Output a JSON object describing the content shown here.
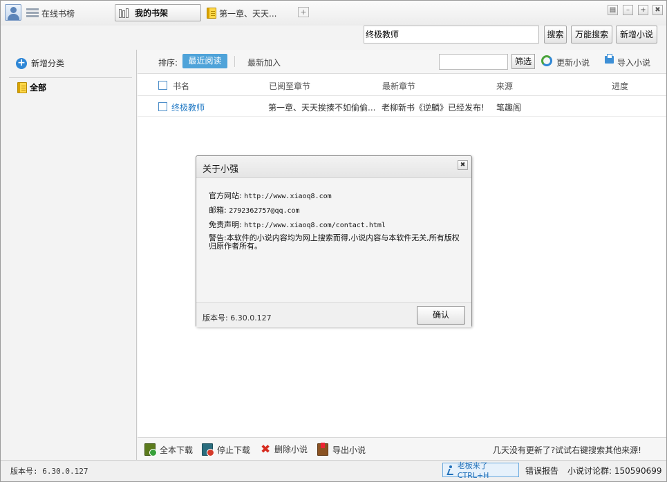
{
  "tabs": {
    "online": "在线书榜",
    "shelf": "我的书架",
    "chapter": "第一章、天天...",
    "add": "+"
  },
  "window_buttons": {
    "menu": "▤",
    "minimize": "–",
    "maximize": "+",
    "close": "✖"
  },
  "search": {
    "value": "终极教师",
    "search_btn": "搜索",
    "universal_btn": "万能搜索",
    "add_novel_btn": "新增小说"
  },
  "sidebar": {
    "add_category": "新增分类",
    "category_all": "全部"
  },
  "toolbar": {
    "sort_label": "排序:",
    "sort_recent": "最近阅读",
    "sort_added": "最新加入",
    "filter_btn": "筛选",
    "update_novels": "更新小说",
    "import_novels": "导入小说"
  },
  "table": {
    "headers": [
      "书名",
      "已阅至章节",
      "最新章节",
      "来源",
      "进度"
    ],
    "rows": [
      {
        "name": "终极教师",
        "read_to": "第一章、天天挨揍不如偷偷...",
        "latest": "老柳新书《逆麟》已经发布!",
        "source": "笔趣阁",
        "progress": ""
      }
    ]
  },
  "bottom_tools": {
    "download_all": "全本下载",
    "stop_download": "停止下载",
    "delete_novel": "删除小说",
    "export_novel": "导出小说",
    "tip": "几天没有更新了?试试右键搜索其他来源!"
  },
  "statusbar": {
    "version": "版本号: 6.30.0.127",
    "boss_key": "老板来了CTRL+H",
    "error_report": "错误报告",
    "discussion_group": "小说讨论群: 150590699"
  },
  "dialog": {
    "title": "关于小强",
    "close": "✖",
    "website_label": "官方网站:",
    "website": "http://www.xiaoq8.com",
    "email_label": "邮箱:",
    "email": "2792362757@qq.com",
    "disclaimer_label": "免责声明:",
    "disclaimer": "http://www.xiaoq8.com/contact.html",
    "warning": "警告:本软件的小说内容均为网上搜索而得,小说内容与本软件无关,所有版权归原作者所有。",
    "version": "版本号: 6.30.0.127",
    "ok": "确认"
  }
}
